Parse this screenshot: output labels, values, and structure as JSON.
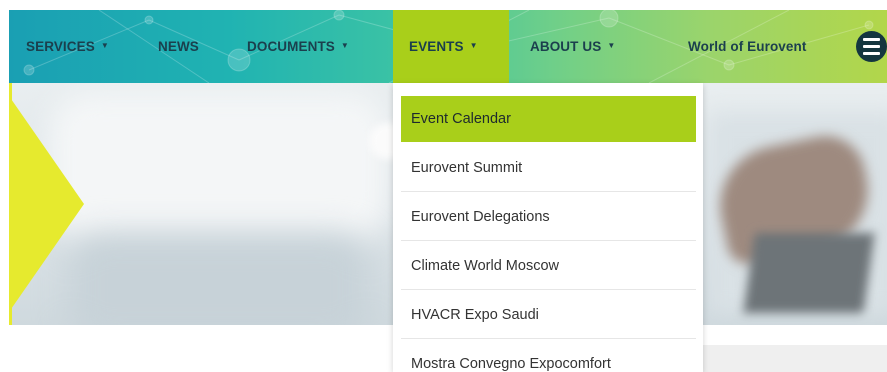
{
  "nav": {
    "items": [
      {
        "label": "SERVICES",
        "has_caret": true
      },
      {
        "label": "NEWS",
        "has_caret": false
      },
      {
        "label": "DOCUMENTS",
        "has_caret": true
      },
      {
        "label": "EVENTS",
        "has_caret": true,
        "active": true
      },
      {
        "label": "ABOUT US",
        "has_caret": true
      },
      {
        "label": "World of Eurovent",
        "has_caret": false
      }
    ],
    "caret": "▼",
    "menu_icon": "hamburger-icon"
  },
  "dropdown": {
    "items": [
      {
        "label": "Event Calendar",
        "active": true
      },
      {
        "label": "Eurovent Summit"
      },
      {
        "label": "Eurovent Delegations"
      },
      {
        "label": "Climate World Moscow"
      },
      {
        "label": "HVACR Expo Saudi"
      },
      {
        "label": "Mostra Convegno Expocomfort"
      }
    ]
  },
  "colors": {
    "accent_green": "#a9cf1a",
    "banner_yellow": "#e6ea2e",
    "nav_text": "#1b3f4d",
    "menu_icon_bg": "#14363f"
  }
}
